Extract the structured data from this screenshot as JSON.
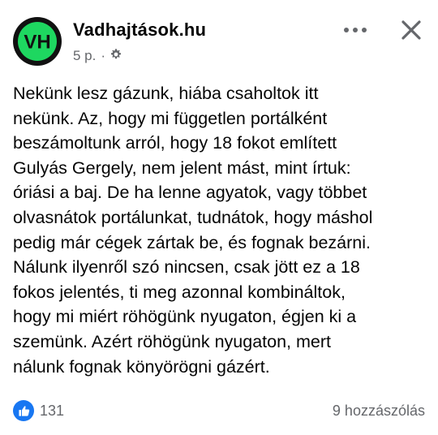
{
  "post": {
    "page_name": "Vadhajtások.hu",
    "avatar_initials": "VH",
    "time_ago": "5 p.",
    "separator": "·",
    "privacy_icon": "gear-icon",
    "more_icon": "more-dots-icon",
    "close_icon": "close-icon",
    "lines": [
      "Nekünk lesz gázunk, hiába csaholtok itt",
      "nekünk. Az, hogy mi független portálként",
      "beszámoltunk arról, hogy 18 fokot említett",
      "Gulyás Gergely, nem jelent mást, mint írtuk:",
      "óriási a baj. De ha lenne agyatok, vagy többet",
      "olvasnátok portálunkat, tudnátok, hogy máshol",
      "pedig már cégek zártak be, és fognak bezárni.",
      "Nálunk ilyenről szó nincsen, csak jött ez a 18",
      "fokos jelentés, ti meg azonnal kombináltok,",
      "hogy mi miért röhögünk nyugaton, égjen ki a",
      "szemünk. Azért röhögünk nyugaton, mert",
      "nálunk fognak könyörögni gázért."
    ],
    "reaction_icon": "like-icon",
    "reaction_count": "131",
    "comment_count": "9 hozzászólás"
  },
  "colors": {
    "avatar_bg": "#111111",
    "avatar_green": "#1ed760",
    "text": "#050505",
    "secondary_text": "#65676b",
    "like_blue": "#1877f2"
  }
}
